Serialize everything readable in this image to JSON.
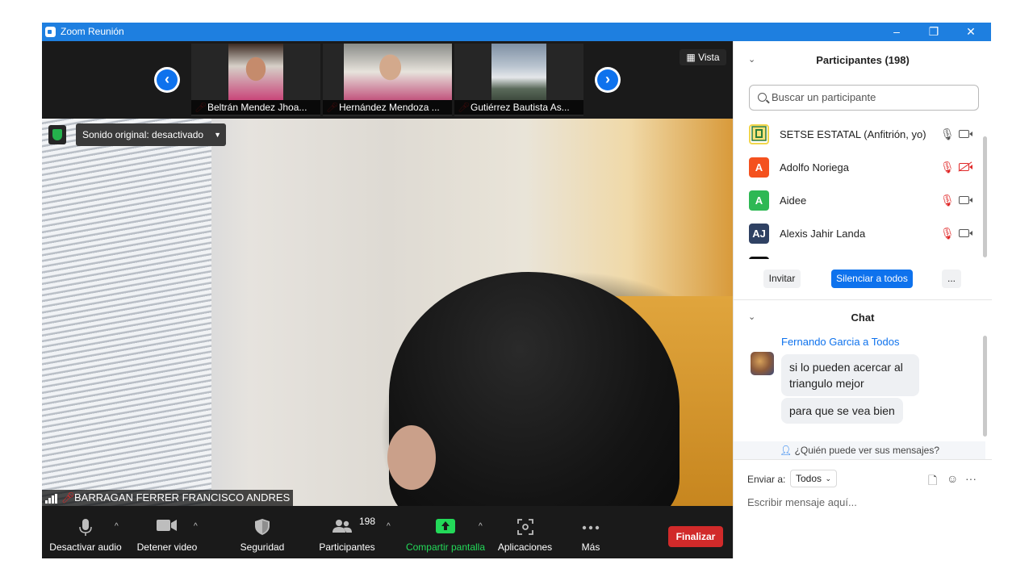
{
  "window": {
    "title": "Zoom Reunión",
    "minimize": "–",
    "restore": "❐",
    "close": "✕"
  },
  "strip": {
    "tiles": [
      {
        "name": "Beltrán Mendez Jhoa..."
      },
      {
        "name": "Hernández Mendoza ..."
      },
      {
        "name": "Gutiérrez Bautista As..."
      }
    ],
    "prev": "‹",
    "next": "›",
    "view_label": "Vista"
  },
  "main_video": {
    "sound_label": "Sonido original: desactivado",
    "speaker_name": "BARRAGAN FERRER FRANCISCO ANDRES"
  },
  "toolbar": {
    "audio": "Desactivar audio",
    "video": "Detener video",
    "security": "Seguridad",
    "participants": "Participantes",
    "participants_count": "198",
    "share": "Compartir pantalla",
    "apps": "Aplicaciones",
    "more": "Más",
    "end": "Finalizar"
  },
  "participants_panel": {
    "title": "Participantes (198)",
    "search_placeholder": "Buscar un participante",
    "list": [
      {
        "name": "SETSE ESTATAL (Anfitrión, yo)",
        "initials": "",
        "color": "#f2d64b",
        "mic": "on",
        "cam": "on"
      },
      {
        "name": "Adolfo Noriega",
        "initials": "A",
        "color": "#f4511e",
        "mic": "off",
        "cam": "off"
      },
      {
        "name": "Aidee",
        "initials": "A",
        "color": "#2eb854",
        "mic": "off",
        "cam": "on"
      },
      {
        "name": "Alexis Jahir Landa",
        "initials": "AJ",
        "color": "#2f4163",
        "mic": "off",
        "cam": "on"
      }
    ],
    "invite": "Invitar",
    "mute_all": "Silenciar a todos",
    "more": "..."
  },
  "chat": {
    "title": "Chat",
    "sender": "Fernando Garcia a Todos",
    "messages": [
      "si lo pueden acercar al triangulo mejor",
      "para que se vea bien"
    ],
    "who_can_see": "¿Quién puede ver sus mensajes?",
    "send_to_label": "Enviar a:",
    "send_to_value": "Todos",
    "input_placeholder": "Escribir mensaje aquí..."
  },
  "colors": {
    "titlebar": "#1e7fe0",
    "accent": "#0e72ed",
    "end_button": "#d12a2a",
    "share_green": "#23d959",
    "muted_red": "#e02828"
  }
}
